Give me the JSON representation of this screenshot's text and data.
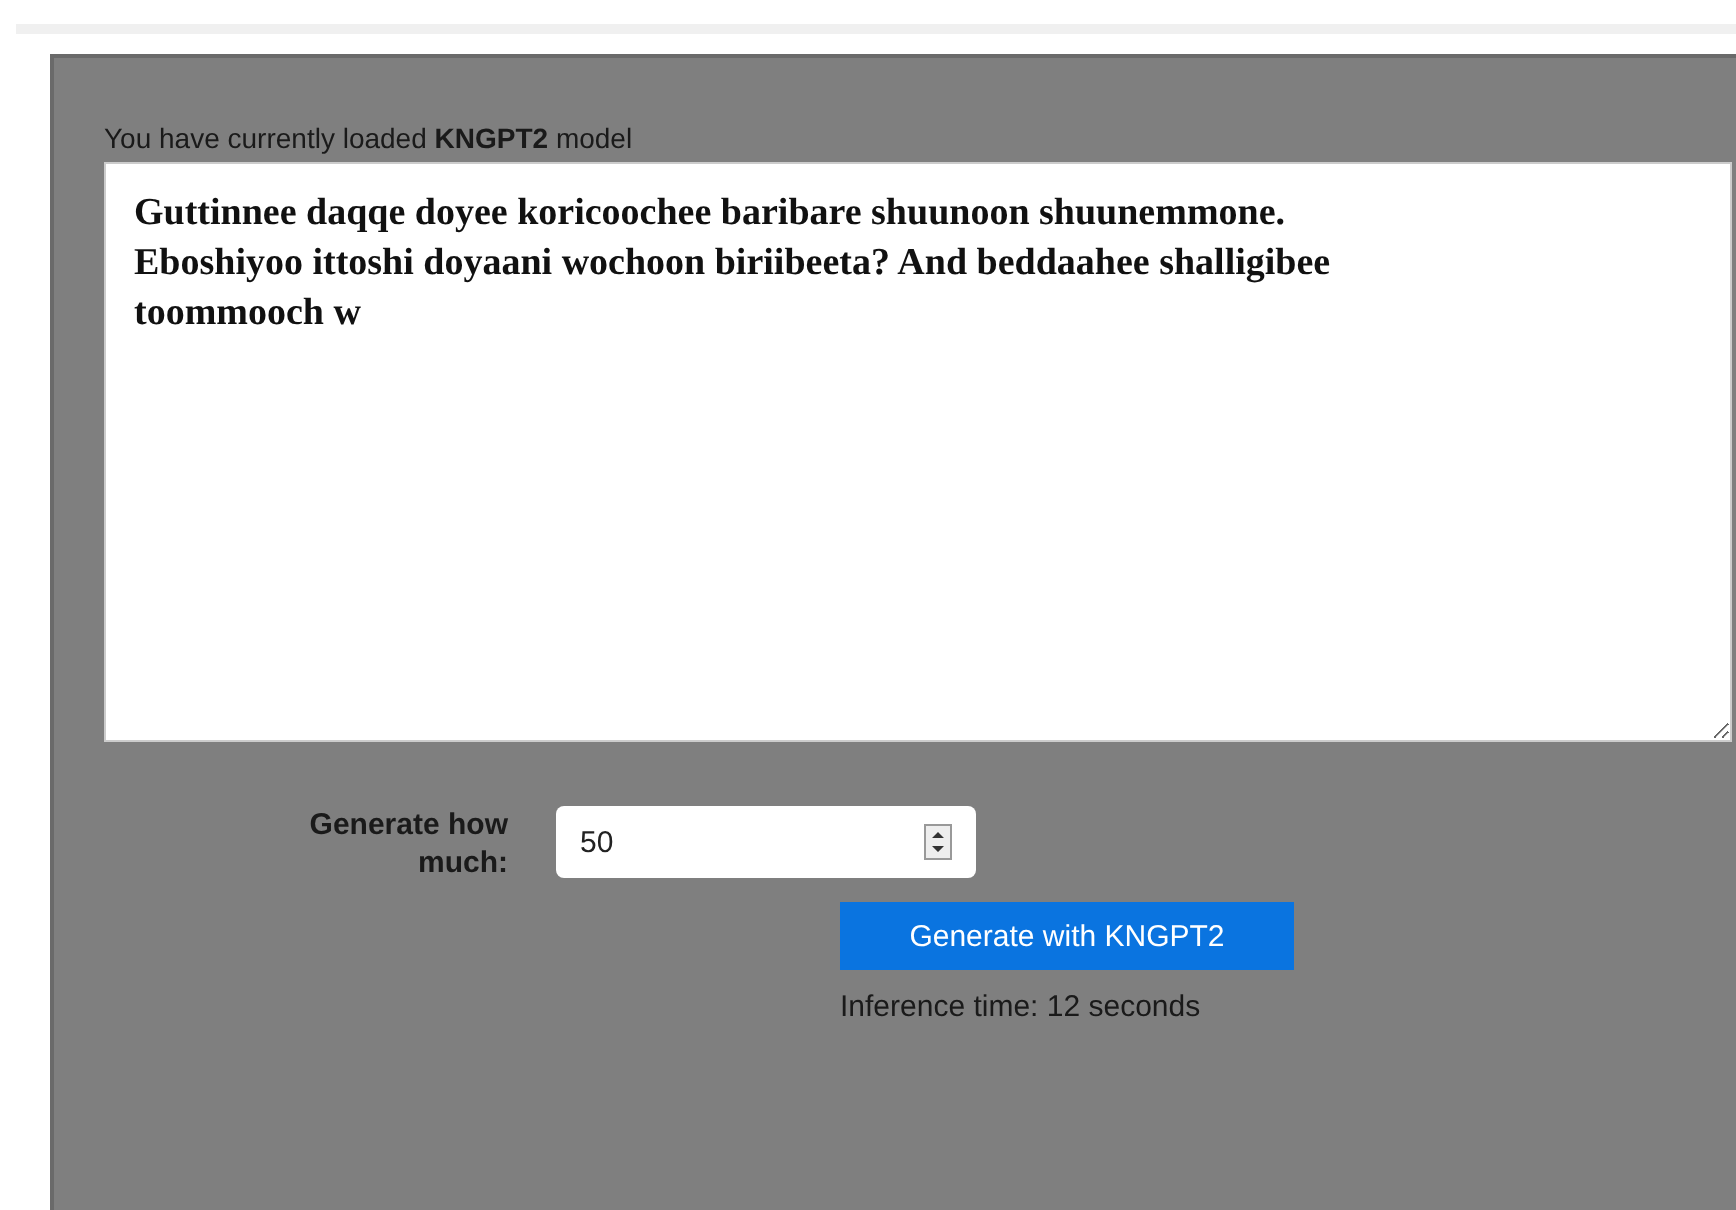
{
  "model_notice": "You have currently loaded **KNGPT2** model",
  "prompt_text": "Guttinnee daqqe doyee koricoochee baribare shuunoon shuunemmone. Eboshiyoo ittoshi doyaani wochoon biriibeeta? And beddaahee shalligibee toommooch w",
  "length_field": {
    "label": "Generate how much:",
    "value": "50"
  },
  "generate_button": "Generate with KNGPT2",
  "inference_time": "Inference time: 12 seconds"
}
